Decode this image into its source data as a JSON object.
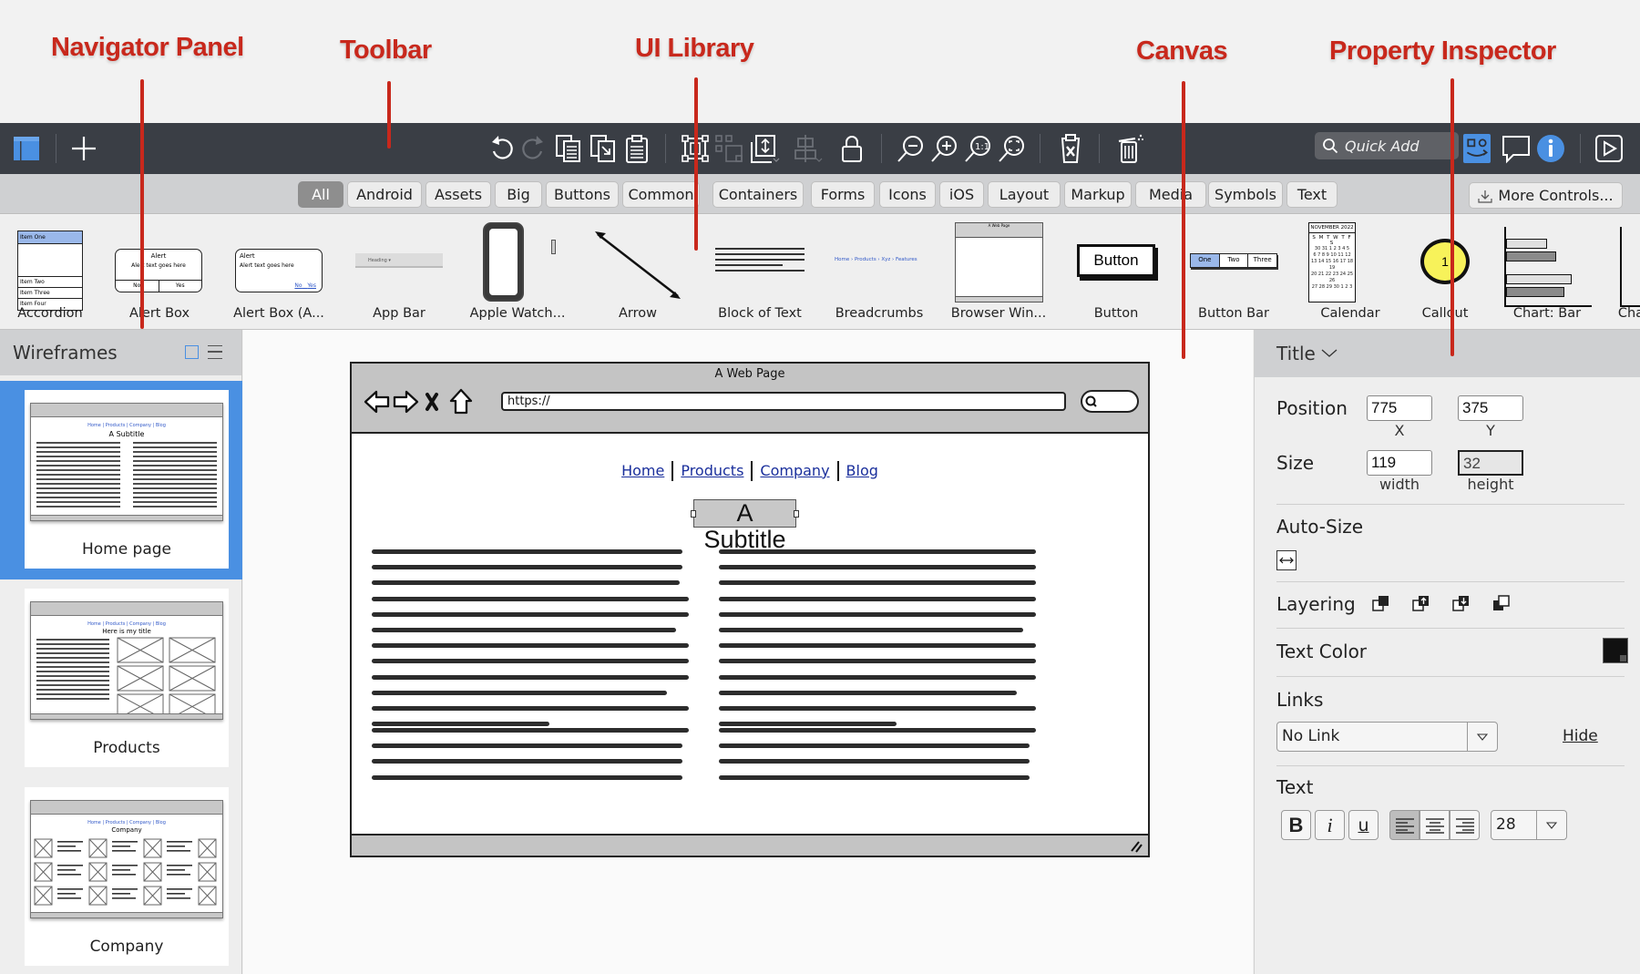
{
  "annotations": [
    {
      "label": "Navigator Panel"
    },
    {
      "label": "Toolbar"
    },
    {
      "label": "UI Library"
    },
    {
      "label": "Canvas"
    },
    {
      "label": "Property Inspector"
    }
  ],
  "toolbar": {
    "left_icons": [
      "navigator-toggle-icon",
      "add-icon"
    ],
    "edit_icons": [
      "undo-icon",
      "redo-icon",
      "copy-icon",
      "duplicate-icon",
      "paste-icon"
    ],
    "arrange_icons": [
      "group-icon",
      "ungroup-icon",
      "arrange-icon",
      "align-icon",
      "lock-icon"
    ],
    "zoom_icons": [
      "zoom-out-icon",
      "zoom-in-icon",
      "zoom-actual-size-icon",
      "zoom-fit-icon"
    ],
    "other_icons": [
      "clear-icon",
      "trash-icon"
    ],
    "quick_add_placeholder": "Quick Add",
    "right_icons": [
      "ui-library-toggle-icon",
      "comments-icon",
      "info-icon",
      "presentation-icon"
    ],
    "accent_color": "#4a90e2"
  },
  "library": {
    "tabs": [
      "All",
      "Android",
      "Assets",
      "Big",
      "Buttons",
      "Common",
      "Containers",
      "Forms",
      "Icons",
      "iOS",
      "Layout",
      "Markup",
      "Media",
      "Symbols",
      "Text"
    ],
    "active_tab": "All",
    "more_controls_label": "More Controls...",
    "items": [
      {
        "label": "Accordion",
        "thumb_texts": [
          "Item One",
          "Item Two",
          "Item Three",
          "Item Four"
        ]
      },
      {
        "label": "Alert Box",
        "thumb_texts": [
          "Alert",
          "Alert text goes here",
          "No",
          "Yes"
        ]
      },
      {
        "label": "Alert Box (A...",
        "thumb_texts": [
          "Alert",
          "Alert text goes here",
          "No",
          "Yes"
        ]
      },
      {
        "label": "App Bar",
        "thumb_texts": [
          "Heading"
        ]
      },
      {
        "label": "Apple Watch..."
      },
      {
        "label": "Arrow"
      },
      {
        "label": "Block of Text"
      },
      {
        "label": "Breadcrumbs",
        "thumb_texts": [
          "Home › Products › Xyz › Features"
        ]
      },
      {
        "label": "Browser Win...",
        "thumb_texts": [
          "A Web Page"
        ]
      },
      {
        "label": "Button",
        "thumb_texts": [
          "Button"
        ]
      },
      {
        "label": "Button Bar",
        "thumb_texts": [
          "One",
          "Two",
          "Three"
        ]
      },
      {
        "label": "Calendar",
        "thumb_texts": [
          "NOVEMBER 2022",
          "S M T W T F S"
        ]
      },
      {
        "label": "Callout",
        "thumb_texts": [
          "1"
        ]
      },
      {
        "label": "Chart: Bar"
      },
      {
        "label": "Cha"
      }
    ]
  },
  "navigator": {
    "title": "Wireframes",
    "view_icons": [
      "grid-view-icon",
      "list-view-icon"
    ],
    "pages": [
      {
        "name": "Home page",
        "selected": true,
        "mini_title": "A Subtitle"
      },
      {
        "name": "Products",
        "selected": false,
        "mini_title": "Here is my title"
      },
      {
        "name": "Company",
        "selected": false,
        "mini_title": "Company"
      }
    ],
    "mini_nav_links": "Home | Products | Company | Blog"
  },
  "canvas": {
    "window_title": "A Web Page",
    "url": "https://",
    "nav_links": [
      "Home",
      "Products",
      "Company",
      "Blog"
    ],
    "subtitle": "A Subtitle"
  },
  "inspector": {
    "element_type": "Title",
    "position_label": "Position",
    "position": {
      "x": "775",
      "y": "375",
      "x_label": "X",
      "y_label": "Y"
    },
    "size_label": "Size",
    "size": {
      "width": "119",
      "height": "32",
      "width_label": "width",
      "height_label": "height"
    },
    "auto_size_label": "Auto-Size",
    "layering_label": "Layering",
    "layering_icons": [
      "bring-to-front-icon",
      "bring-forward-icon",
      "send-backward-icon",
      "send-to-back-icon"
    ],
    "text_color_label": "Text Color",
    "text_color": "#111111",
    "links_label": "Links",
    "link_value": "No Link",
    "hide_label": "Hide",
    "text_label": "Text",
    "bold": "B",
    "italic": "i",
    "underline": "u",
    "alignment": "left",
    "font_size": "28"
  }
}
